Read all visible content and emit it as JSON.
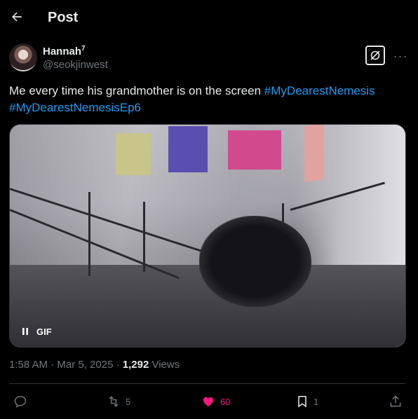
{
  "header": {
    "title": "Post",
    "back_icon": "arrow-left-icon"
  },
  "post": {
    "author": {
      "display_name": "Hannah",
      "badge": "7",
      "handle": "@seokjinwest"
    },
    "text": "Me every time his grandmother is on the screen",
    "hashtags": [
      "#MyDearestNemesis",
      "#MyDearestNemesisEp6"
    ],
    "media": {
      "type": "gif",
      "label": "GIF",
      "control_icon": "pause-icon"
    },
    "timestamp": "1:58 AM · Mar 5, 2025 · ",
    "views_count": "1,292",
    "views_label": " Views"
  },
  "actions": {
    "reply": {
      "icon": "reply-icon",
      "count": ""
    },
    "retweet": {
      "icon": "retweet-icon",
      "count": "5"
    },
    "like": {
      "icon": "heart-filled-icon",
      "count": "60",
      "color": "#f91880"
    },
    "bookmark": {
      "icon": "bookmark-icon",
      "count": "1"
    },
    "share": {
      "icon": "share-icon"
    }
  },
  "colors": {
    "background": "#000000",
    "text": "#e7e9ea",
    "muted": "#71767b",
    "link": "#1d9bf0",
    "like": "#f91880"
  }
}
